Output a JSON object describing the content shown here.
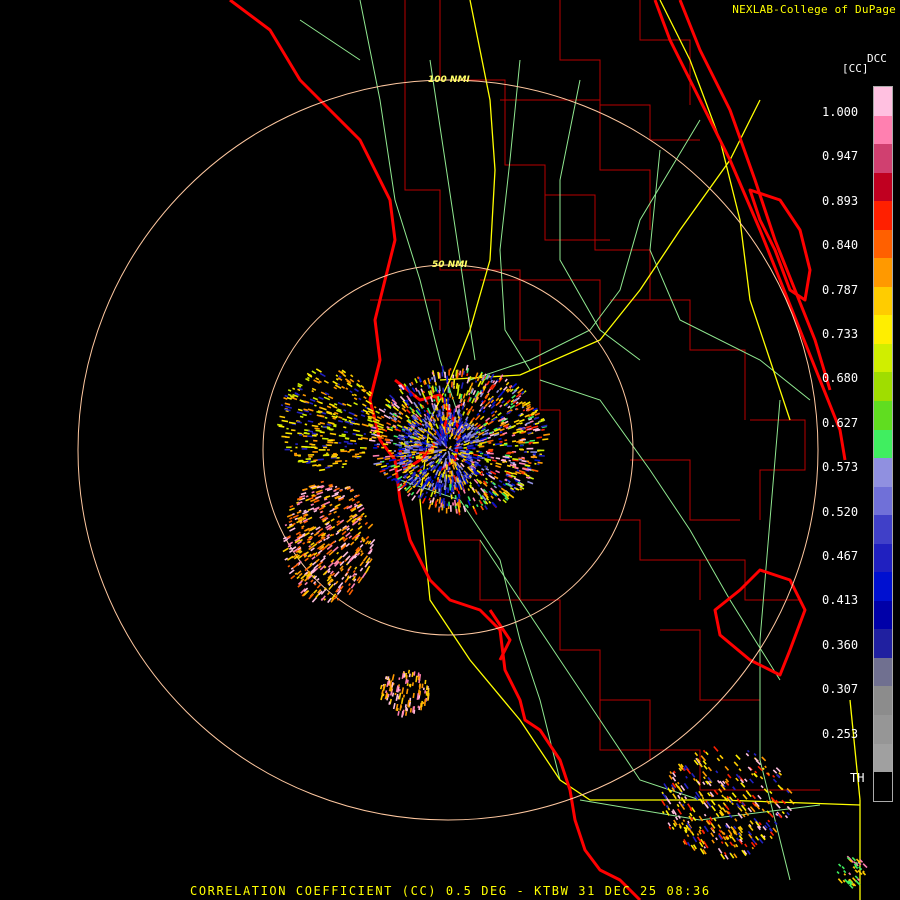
{
  "header": {
    "credit": "NEXLAB-College of DuPage",
    "product_code": "DCC",
    "unit": "[CC]"
  },
  "footer": {
    "caption": "CORRELATION COEFFICIENT (CC) 0.5 DEG - KTBW 31 DEC 25 08:36"
  },
  "range_rings": [
    {
      "label": "50 NMI"
    },
    {
      "label": "100 NMI"
    }
  ],
  "color_scale": {
    "labels": [
      "1.000",
      "0.947",
      "0.893",
      "0.840",
      "0.787",
      "0.733",
      "0.680",
      "0.627",
      "0.573",
      "0.520",
      "0.467",
      "0.413",
      "0.360",
      "0.307",
      "0.253",
      "TH"
    ],
    "colors": [
      "#ffc0e0",
      "#ff80b0",
      "#d04070",
      "#c00020",
      "#ff2000",
      "#ff6000",
      "#ff9900",
      "#ffcc00",
      "#ffee00",
      "#d0ee00",
      "#a0dd00",
      "#60dd20",
      "#40ee60",
      "#9090e0",
      "#7070d8",
      "#4040c8",
      "#2020c0",
      "#0010d0",
      "#0000a8",
      "#2020a0",
      "#707090",
      "#8c8c8c",
      "#969696",
      "#a0a0a0",
      "#000000"
    ]
  },
  "colors": {
    "coast": "#ff0000",
    "county": "#c00000",
    "highway": "#90e890",
    "interstate": "#ffff00",
    "ring": "#ffc8a0"
  }
}
